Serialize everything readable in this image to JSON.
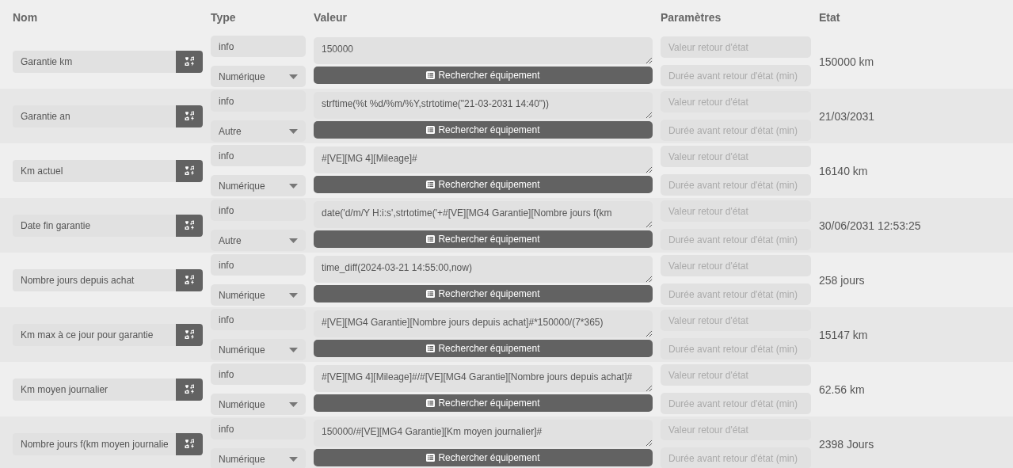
{
  "columns": [
    "Nom",
    "Type",
    "Valeur",
    "Paramètres",
    "Etat"
  ],
  "rows": [
    {
      "name": "Garantie km",
      "subtype": "info",
      "type": "Numérique",
      "value": "150000",
      "button": "Rechercher équipement",
      "return_value_placeholder": "Valeur retour d'état",
      "duration_placeholder": "Durée avant retour d'état (min)",
      "state": "150000 km"
    },
    {
      "name": "Garantie an",
      "subtype": "info",
      "type": "Autre",
      "value": "strftime(%t %d/%m/%Y,strtotime(\"21-03-2031 14:40\"))",
      "button": "Rechercher équipement",
      "return_value_placeholder": "Valeur retour d'état",
      "duration_placeholder": "Durée avant retour d'état (min)",
      "state": "21/03/2031"
    },
    {
      "name": "Km actuel",
      "subtype": "info",
      "type": "Numérique",
      "value": "#[VE][MG 4][Mileage]#",
      "button": "Rechercher équipement",
      "return_value_placeholder": "Valeur retour d'état",
      "duration_placeholder": "Durée avant retour d'état (min)",
      "state": "16140 km"
    },
    {
      "name": "Date fin garantie",
      "subtype": "info",
      "type": "Autre",
      "value": "date('d/m/Y H:i:s',strtotime('+#[VE][MG4 Garantie][Nombre jours f(km",
      "button": "Rechercher équipement",
      "return_value_placeholder": "Valeur retour d'état",
      "duration_placeholder": "Durée avant retour d'état (min)",
      "state": "30/06/2031 12:53:25"
    },
    {
      "name": "Nombre jours depuis achat",
      "subtype": "info",
      "type": "Numérique",
      "value": "time_diff(2024-03-21 14:55:00,now)",
      "button": "Rechercher équipement",
      "return_value_placeholder": "Valeur retour d'état",
      "duration_placeholder": "Durée avant retour d'état (min)",
      "state": "258 jours"
    },
    {
      "name": "Km max à ce jour pour garantie",
      "subtype": "info",
      "type": "Numérique",
      "value": "#[VE][MG4 Garantie][Nombre jours depuis achat]#*150000/(7*365)",
      "button": "Rechercher équipement",
      "return_value_placeholder": "Valeur retour d'état",
      "duration_placeholder": "Durée avant retour d'état (min)",
      "state": "15147 km"
    },
    {
      "name": "Km moyen journalier",
      "subtype": "info",
      "type": "Numérique",
      "value": "#[VE][MG 4][Mileage]#/#[VE][MG4 Garantie][Nombre jours depuis achat]#",
      "button": "Rechercher équipement",
      "return_value_placeholder": "Valeur retour d'état",
      "duration_placeholder": "Durée avant retour d'état (min)",
      "state": "62.56 km"
    },
    {
      "name": "Nombre jours f(km moyen journalie",
      "subtype": "info",
      "type": "Numérique",
      "value": "150000/#[VE][MG4 Garantie][Km moyen journalier]#",
      "button": "Rechercher équipement",
      "return_value_placeholder": "Valeur retour d'état",
      "duration_placeholder": "Durée avant retour d'état (min)",
      "state": "2398 Jours"
    }
  ]
}
